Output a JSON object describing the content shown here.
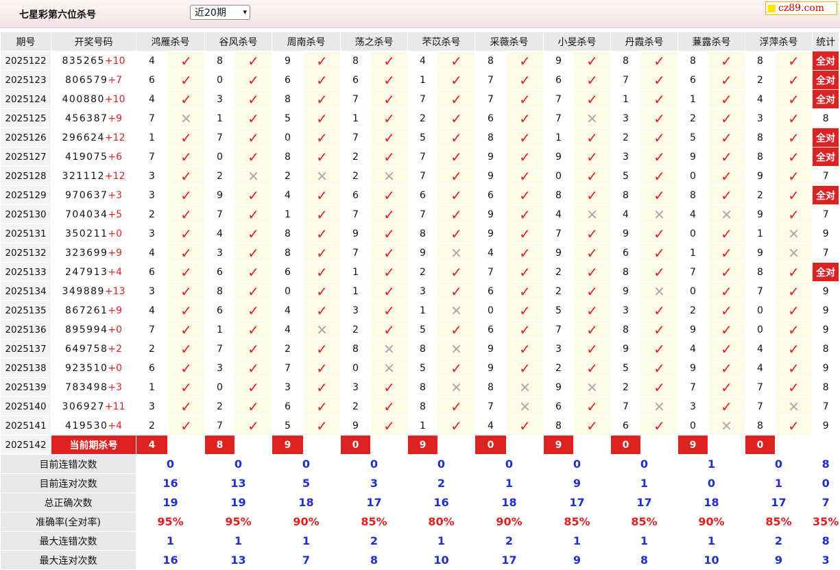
{
  "header": {
    "title": "七星彩第六位杀号",
    "period_select": "近20期",
    "logo_text": "cz89.com"
  },
  "columns": {
    "issue": "期号",
    "number": "开奖号码",
    "stat": "统计",
    "experts": [
      "鸿雁杀号",
      "谷风杀号",
      "周南杀号",
      "荡之杀号",
      "芣苡杀号",
      "采薇杀号",
      "小旻杀号",
      "丹霞杀号",
      "蒹露杀号",
      "浮萍杀号"
    ]
  },
  "rows": [
    {
      "issue": "2025122",
      "digits": "835265",
      "add": "+10",
      "kills": [
        "4",
        "8",
        "9",
        "8",
        "4",
        "8",
        "9",
        "8",
        "8",
        "8"
      ],
      "marks": "1111111111",
      "stat": "全对"
    },
    {
      "issue": "2025123",
      "digits": "806579",
      "add": "+7",
      "kills": [
        "6",
        "0",
        "6",
        "6",
        "1",
        "7",
        "6",
        "7",
        "6",
        "2"
      ],
      "marks": "1111111111",
      "stat": "全对"
    },
    {
      "issue": "2025124",
      "digits": "400880",
      "add": "+10",
      "kills": [
        "4",
        "3",
        "8",
        "7",
        "7",
        "7",
        "7",
        "1",
        "1",
        "4"
      ],
      "marks": "1111111111",
      "stat": "全对"
    },
    {
      "issue": "2025125",
      "digits": "456387",
      "add": "+9",
      "kills": [
        "7",
        "1",
        "5",
        "1",
        "2",
        "6",
        "7",
        "3",
        "2",
        "3"
      ],
      "marks": "0111110111",
      "stat": "8"
    },
    {
      "issue": "2025126",
      "digits": "296624",
      "add": "+12",
      "kills": [
        "1",
        "7",
        "0",
        "7",
        "5",
        "8",
        "1",
        "2",
        "5",
        "8"
      ],
      "marks": "1111111111",
      "stat": "全对"
    },
    {
      "issue": "2025127",
      "digits": "419075",
      "add": "+6",
      "kills": [
        "7",
        "0",
        "8",
        "2",
        "7",
        "9",
        "9",
        "3",
        "9",
        "8"
      ],
      "marks": "1111111111",
      "stat": "全对"
    },
    {
      "issue": "2025128",
      "digits": "321112",
      "add": "+12",
      "kills": [
        "3",
        "2",
        "2",
        "2",
        "7",
        "9",
        "0",
        "5",
        "0",
        "9"
      ],
      "marks": "1000111111",
      "stat": "7"
    },
    {
      "issue": "2025129",
      "digits": "970637",
      "add": "+3",
      "kills": [
        "3",
        "9",
        "4",
        "6",
        "6",
        "6",
        "8",
        "8",
        "8",
        "2"
      ],
      "marks": "1111111111",
      "stat": "全对"
    },
    {
      "issue": "2025130",
      "digits": "704034",
      "add": "+5",
      "kills": [
        "2",
        "7",
        "1",
        "7",
        "7",
        "9",
        "4",
        "4",
        "4",
        "9"
      ],
      "marks": "1111110001",
      "stat": "7"
    },
    {
      "issue": "2025131",
      "digits": "350211",
      "add": "+0",
      "kills": [
        "3",
        "4",
        "8",
        "9",
        "8",
        "9",
        "7",
        "9",
        "0",
        "1"
      ],
      "marks": "1111111110",
      "stat": "9"
    },
    {
      "issue": "2025132",
      "digits": "323699",
      "add": "+9",
      "kills": [
        "4",
        "3",
        "8",
        "7",
        "9",
        "4",
        "9",
        "6",
        "1",
        "9"
      ],
      "marks": "1111011110",
      "stat": "7"
    },
    {
      "issue": "2025133",
      "digits": "247913",
      "add": "+4",
      "kills": [
        "6",
        "6",
        "6",
        "1",
        "2",
        "7",
        "2",
        "8",
        "7",
        "8"
      ],
      "marks": "1111111111",
      "stat": "全对"
    },
    {
      "issue": "2025134",
      "digits": "349889",
      "add": "+13",
      "kills": [
        "3",
        "8",
        "0",
        "1",
        "3",
        "6",
        "2",
        "9",
        "0",
        "7"
      ],
      "marks": "1111111011",
      "stat": "9"
    },
    {
      "issue": "2025135",
      "digits": "867261",
      "add": "+9",
      "kills": [
        "4",
        "6",
        "4",
        "3",
        "1",
        "0",
        "5",
        "3",
        "2",
        "0"
      ],
      "marks": "1111011111",
      "stat": "9"
    },
    {
      "issue": "2025136",
      "digits": "895994",
      "add": "+0",
      "kills": [
        "7",
        "1",
        "4",
        "2",
        "5",
        "6",
        "7",
        "8",
        "9",
        "0"
      ],
      "marks": "1101111111",
      "stat": "9"
    },
    {
      "issue": "2025137",
      "digits": "649758",
      "add": "+2",
      "kills": [
        "2",
        "7",
        "2",
        "8",
        "8",
        "9",
        "3",
        "9",
        "4",
        "4"
      ],
      "marks": "1110011111",
      "stat": "8"
    },
    {
      "issue": "2025138",
      "digits": "923510",
      "add": "+0",
      "kills": [
        "6",
        "3",
        "7",
        "0",
        "5",
        "9",
        "2",
        "5",
        "9",
        "4"
      ],
      "marks": "1110111111",
      "stat": "9"
    },
    {
      "issue": "2025139",
      "digits": "783498",
      "add": "+3",
      "kills": [
        "1",
        "0",
        "3",
        "3",
        "8",
        "8",
        "9",
        "2",
        "7",
        "7"
      ],
      "marks": "1111000111",
      "stat": "8"
    },
    {
      "issue": "2025140",
      "digits": "306927",
      "add": "+11",
      "kills": [
        "3",
        "2",
        "6",
        "2",
        "8",
        "7",
        "6",
        "7",
        "3",
        "7"
      ],
      "marks": "1111101010",
      "stat": "7"
    },
    {
      "issue": "2025141",
      "digits": "419530",
      "add": "+4",
      "kills": [
        "2",
        "7",
        "5",
        "9",
        "1",
        "4",
        "8",
        "6",
        "0",
        "8"
      ],
      "marks": "1111111101",
      "stat": "9"
    }
  ],
  "current": {
    "issue": "2025142",
    "label": "当前期杀号",
    "kills": [
      "4",
      "8",
      "9",
      "0",
      "9",
      "0",
      "9",
      "0",
      "9",
      "0"
    ]
  },
  "stats": [
    {
      "label": "目前连错次数",
      "values": [
        "0",
        "0",
        "0",
        "0",
        "0",
        "0",
        "0",
        "0",
        "1",
        "0"
      ],
      "stat": "8"
    },
    {
      "label": "目前连对次数",
      "values": [
        "16",
        "13",
        "5",
        "3",
        "2",
        "1",
        "9",
        "1",
        "0",
        "1"
      ],
      "stat": "0"
    },
    {
      "label": "总正确次数",
      "values": [
        "19",
        "19",
        "18",
        "17",
        "16",
        "18",
        "17",
        "17",
        "18",
        "17"
      ],
      "stat": "7"
    },
    {
      "label": "准确率(全对率)",
      "values": [
        "95%",
        "95%",
        "90%",
        "85%",
        "80%",
        "90%",
        "85%",
        "85%",
        "90%",
        "85%"
      ],
      "stat": "35%",
      "red": true
    },
    {
      "label": "最大连错次数",
      "values": [
        "1",
        "1",
        "1",
        "2",
        "1",
        "2",
        "1",
        "1",
        "1",
        "2"
      ],
      "stat": "8"
    },
    {
      "label": "最大连对次数",
      "values": [
        "16",
        "13",
        "7",
        "8",
        "10",
        "17",
        "9",
        "8",
        "10",
        "9"
      ],
      "stat": "3"
    }
  ],
  "icons": {
    "correct": "check-icon",
    "wrong": "cross-icon"
  },
  "colors": {
    "accent_red": "#d22",
    "stat_blue": "#1e2fd0",
    "header_gray": "#e9e9e9"
  }
}
